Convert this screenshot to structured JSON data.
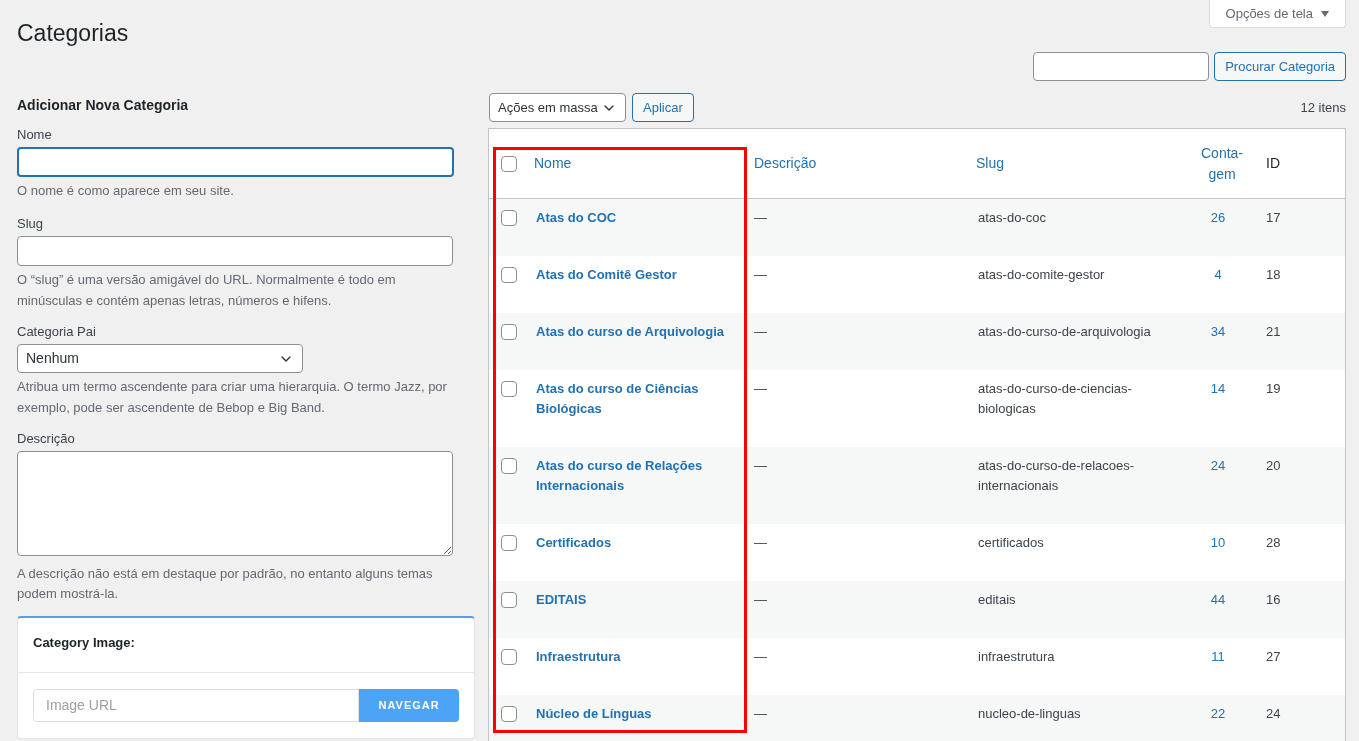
{
  "page_title": "Categorias",
  "screen_options": {
    "label": "Opções de tela"
  },
  "add_form": {
    "heading": "Adicionar Nova Categoria",
    "name_field": {
      "label": "Nome",
      "focused": true,
      "hint": "O nome é como aparece em seu site."
    },
    "slug_field": {
      "label": "Slug",
      "hint": "O “slug” é uma versão amigável do URL. Normalmente é todo em minúsculas e contém apenas letras, números e hifens."
    },
    "parent_field": {
      "label": "Categoria Pai",
      "value": "Nenhum",
      "hint": "Atribua um termo ascendente para criar uma hierarquia. O termo Jazz, por exemplo, pode ser ascendente de Bebop e Big Band."
    },
    "description_field": {
      "label": "Descrição",
      "hint": "A descrição não está em destaque por padrão, no entanto alguns temas podem mostrá-la."
    },
    "image_card": {
      "title": "Category Image:",
      "url_placeholder": "Image URL",
      "browse_button": "NAVEGAR"
    }
  },
  "search": {
    "button": "Procurar Categoria"
  },
  "bulk_actions": {
    "value": "Ações em massa",
    "apply_button": "Aplicar"
  },
  "item_count": "12 itens",
  "table": {
    "select_all_checked": false,
    "columns": [
      {
        "label": "Nome",
        "sortable": true
      },
      {
        "label": "Descrição",
        "sortable": true
      },
      {
        "label": "Slug",
        "sortable": true
      },
      {
        "label": "Conta-gem",
        "sortable": true
      },
      {
        "label": "ID",
        "sortable": false
      }
    ],
    "rows": [
      {
        "name": "Atas do COC",
        "description": "—",
        "slug": "atas-do-coc",
        "count": "26",
        "id": "17",
        "checked": false
      },
      {
        "name": "Atas do Comitê Gestor",
        "description": "—",
        "slug": "atas-do-comite-gestor",
        "count": "4",
        "id": "18",
        "checked": false
      },
      {
        "name": "Atas do curso de Arquivologia",
        "description": "—",
        "slug": "atas-do-curso-de-arquivologia",
        "count": "34",
        "id": "21",
        "checked": false
      },
      {
        "name": "Atas do curso de Ciências Biológicas",
        "description": "—",
        "slug": "atas-do-curso-de-ciencias-biologicas",
        "count": "14",
        "id": "19",
        "checked": false
      },
      {
        "name": "Atas do curso de Relações Internacionais",
        "description": "—",
        "slug": "atas-do-curso-de-relacoes-internacionais",
        "count": "24",
        "id": "20",
        "checked": false
      },
      {
        "name": "Certificados",
        "description": "—",
        "slug": "certificados",
        "count": "10",
        "id": "28",
        "checked": false
      },
      {
        "name": "EDITAIS",
        "description": "—",
        "slug": "editais",
        "count": "44",
        "id": "16",
        "checked": false
      },
      {
        "name": "Infraestrutura",
        "description": "—",
        "slug": "infraestrutura",
        "count": "11",
        "id": "27",
        "checked": false
      },
      {
        "name": "Núcleo de Línguas",
        "description": "—",
        "slug": "nucleo-de-linguas",
        "count": "22",
        "id": "24",
        "checked": false
      }
    ]
  }
}
